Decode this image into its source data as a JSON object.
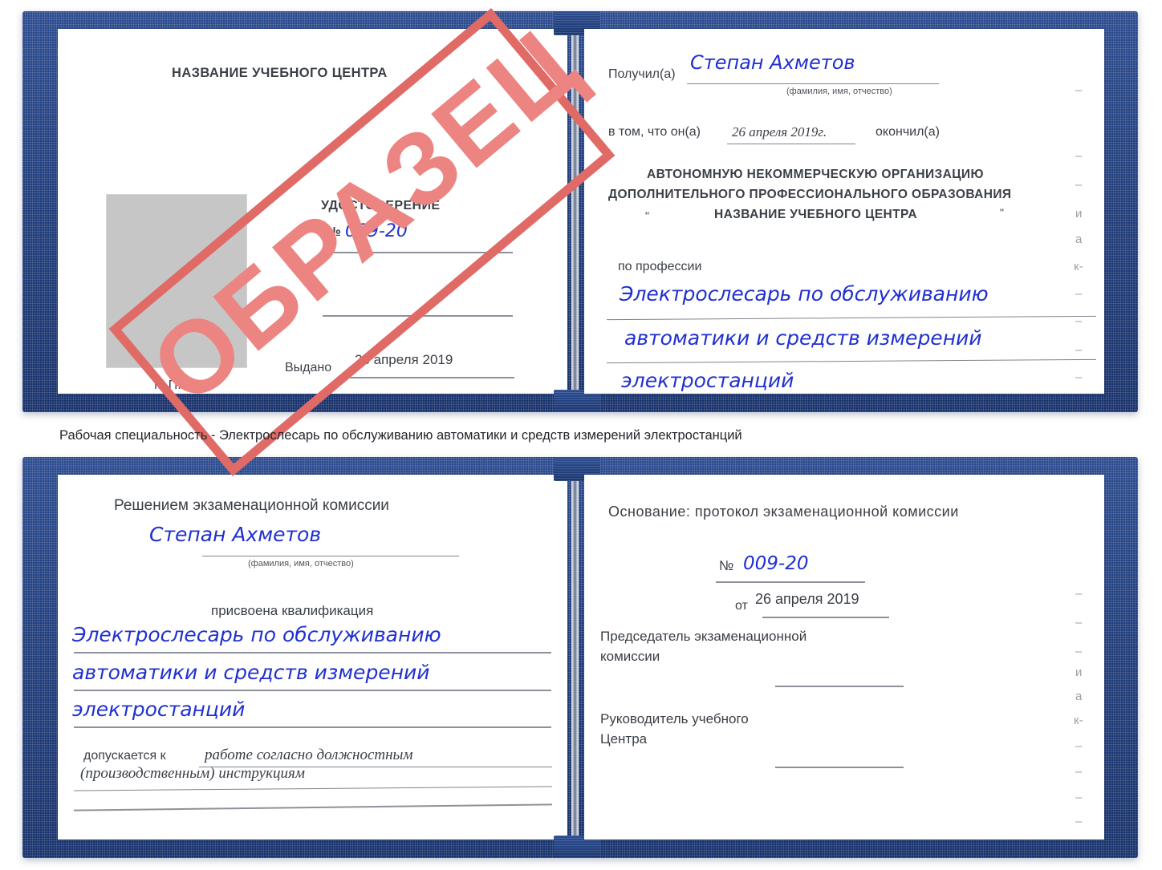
{
  "colors": {
    "cover_blue": "#1F3C7A",
    "handwriting_blue": "#2030D0",
    "stamp_red": "#E06A66",
    "stamp_fill": "#EC8581",
    "photo_gray": "#C6C6C6",
    "rule_gray": "#8D9199",
    "text_gray": "#3A3F46"
  },
  "watermark": {
    "text": "ОБРАЗЕЦ"
  },
  "caption": {
    "text": "Рабочая специальность - Электрослесарь по обслуживанию автоматики и средств измерений электростанций"
  },
  "certificate_top": {
    "left_page": {
      "center_name": "НАЗВАНИЕ УЧЕБНОГО ЦЕНТРА",
      "doc_title": "УДОСТОВЕРЕНИЕ",
      "number_label": "№",
      "number_value": "009-20",
      "issued_label": "Выдано",
      "issued_value": "26 апреля 2019",
      "seal_label": "М.П.",
      "photo_placeholder": "photo-placeholder"
    },
    "right_page": {
      "received_label": "Получил(а)",
      "received_value": "Степан Ахметов",
      "fio_hint": "(фамилия, имя, отчество)",
      "in_that_label": "в том, что он(а)",
      "in_that_value": "26 апреля 2019г.",
      "finished_label": "окончил(а)",
      "org_line1": "АВТОНОМНУЮ НЕКОММЕРЧЕСКУЮ ОРГАНИЗАЦИЮ",
      "org_line2": "ДОПОЛНИТЕЛЬНОГО ПРОФЕССИОНАЛЬНОГО ОБРАЗОВАНИЯ",
      "org_quote_open": "\"",
      "org_line3": "НАЗВАНИЕ УЧЕБНОГО ЦЕНТРА",
      "org_quote_close": "\"",
      "profession_label": "по профессии",
      "profession_line1": "Электрослесарь по обслуживанию",
      "profession_line2": "автоматики и средств измерений",
      "profession_line3": "электростанций",
      "margin_ghosts": [
        "–",
        "–",
        "–",
        "и",
        "а",
        "к-",
        "–",
        "–",
        "–",
        "–"
      ]
    }
  },
  "certificate_bottom": {
    "left_page": {
      "commission_title": "Решением экзаменационной комиссии",
      "name_value": "Степан Ахметов",
      "fio_hint": "(фамилия, имя, отчество)",
      "qualification_label": "присвоена квалификация",
      "qualification_line1": "Электрослесарь по обслуживанию",
      "qualification_line2": "автоматики и средств измерений",
      "qualification_line3": "электростанций",
      "admitted_label": "допускается к",
      "admitted_value_line1": "работе согласно должностным",
      "admitted_value_line2": "(производственным) инструкциям"
    },
    "right_page": {
      "basis_label": "Основание: протокол экзаменационной комиссии",
      "number_label": "№",
      "number_value": "009-20",
      "date_label": "от",
      "date_value": "26 апреля 2019",
      "chairman_line1": "Председатель экзаменационной",
      "chairman_line2": "комиссии",
      "head_line1": "Руководитель учебного",
      "head_line2": "Центра",
      "margin_ghosts": [
        "–",
        "–",
        "–",
        "и",
        "а",
        "к-",
        "–",
        "–",
        "–",
        "–"
      ]
    }
  }
}
